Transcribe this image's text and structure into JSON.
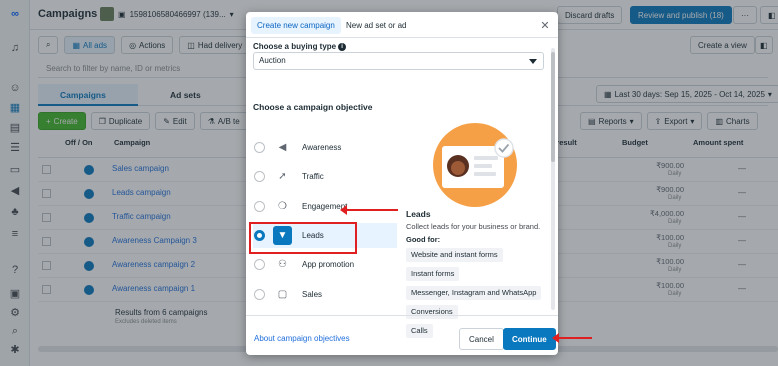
{
  "topbar": {
    "title": "Campaigns",
    "account_id": "1598106580466997 (139...",
    "discard_label": "Discard drafts",
    "publish_label": "Review and publish (18)"
  },
  "toolbar": {
    "all_ads_label": "All ads",
    "actions_label": "Actions",
    "had_delivery_label": "Had delivery",
    "create_view_label": "Create a view",
    "search_placeholder": "Search to filter by name, ID or metrics"
  },
  "level_tabs": {
    "campaigns_label": "Campaigns",
    "adsets_label": "Ad sets",
    "date_range": "Last 30 days: Sep 15, 2025 - Oct 14, 2025"
  },
  "actions_bar": {
    "create_label": "Create",
    "duplicate_label": "Duplicate",
    "edit_label": "Edit",
    "ab_label": "A/B te",
    "reports_label": "Reports",
    "export_label": "Export",
    "charts_label": "Charts"
  },
  "table": {
    "headers": {
      "off_on": "Off / On",
      "campaign": "Campaign",
      "cost_per_result": "t per result",
      "budget": "Budget",
      "amount_spent": "Amount spent"
    },
    "rows": [
      {
        "name": "Sales campaign",
        "budget": "₹900.00",
        "period": "Daily",
        "spent": "—"
      },
      {
        "name": "Leads campaign",
        "budget": "₹900.00",
        "period": "Daily",
        "spent": "—"
      },
      {
        "name": "Traffic campaign",
        "budget": "₹4,000.00",
        "period": "Daily",
        "spent": "—"
      },
      {
        "name": "Awareness Campaign 3",
        "budget": "₹100.00",
        "period": "Daily",
        "spent": "—"
      },
      {
        "name": "Awareness campaign 2",
        "budget": "₹100.00",
        "period": "Daily",
        "spent": "—"
      },
      {
        "name": "Awareness campaign 1",
        "budget": "₹100.00",
        "period": "Daily",
        "spent": "—"
      }
    ],
    "results_label": "Results from 6 campaigns",
    "results_sub": "Excludes deleted items"
  },
  "modal": {
    "tab_new_campaign": "Create new campaign",
    "tab_new_adset": "New ad set or ad",
    "buying_type_label": "Choose a buying type",
    "buying_type_value": "Auction",
    "objective_label": "Choose a campaign objective",
    "objectives": [
      {
        "label": "Awareness",
        "icon": "megaphone-icon"
      },
      {
        "label": "Traffic",
        "icon": "cursor-icon"
      },
      {
        "label": "Engagement",
        "icon": "chat-icon"
      },
      {
        "label": "Leads",
        "icon": "funnel-icon"
      },
      {
        "label": "App promotion",
        "icon": "people-icon"
      },
      {
        "label": "Sales",
        "icon": "bag-icon"
      }
    ],
    "selected_index": 3,
    "detail": {
      "title": "Leads",
      "description": "Collect leads for your business or brand.",
      "good_for_label": "Good for:",
      "good_for": [
        "Website and instant forms",
        "Instant forms",
        "Messenger, Instagram and WhatsApp",
        "Conversions",
        "Calls"
      ]
    },
    "about_link": "About campaign objectives",
    "cancel_label": "Cancel",
    "continue_label": "Continue"
  },
  "colors": {
    "accent": "#0a78be",
    "annotation_red": "#e02020",
    "illustration_orange": "#f5a046"
  }
}
